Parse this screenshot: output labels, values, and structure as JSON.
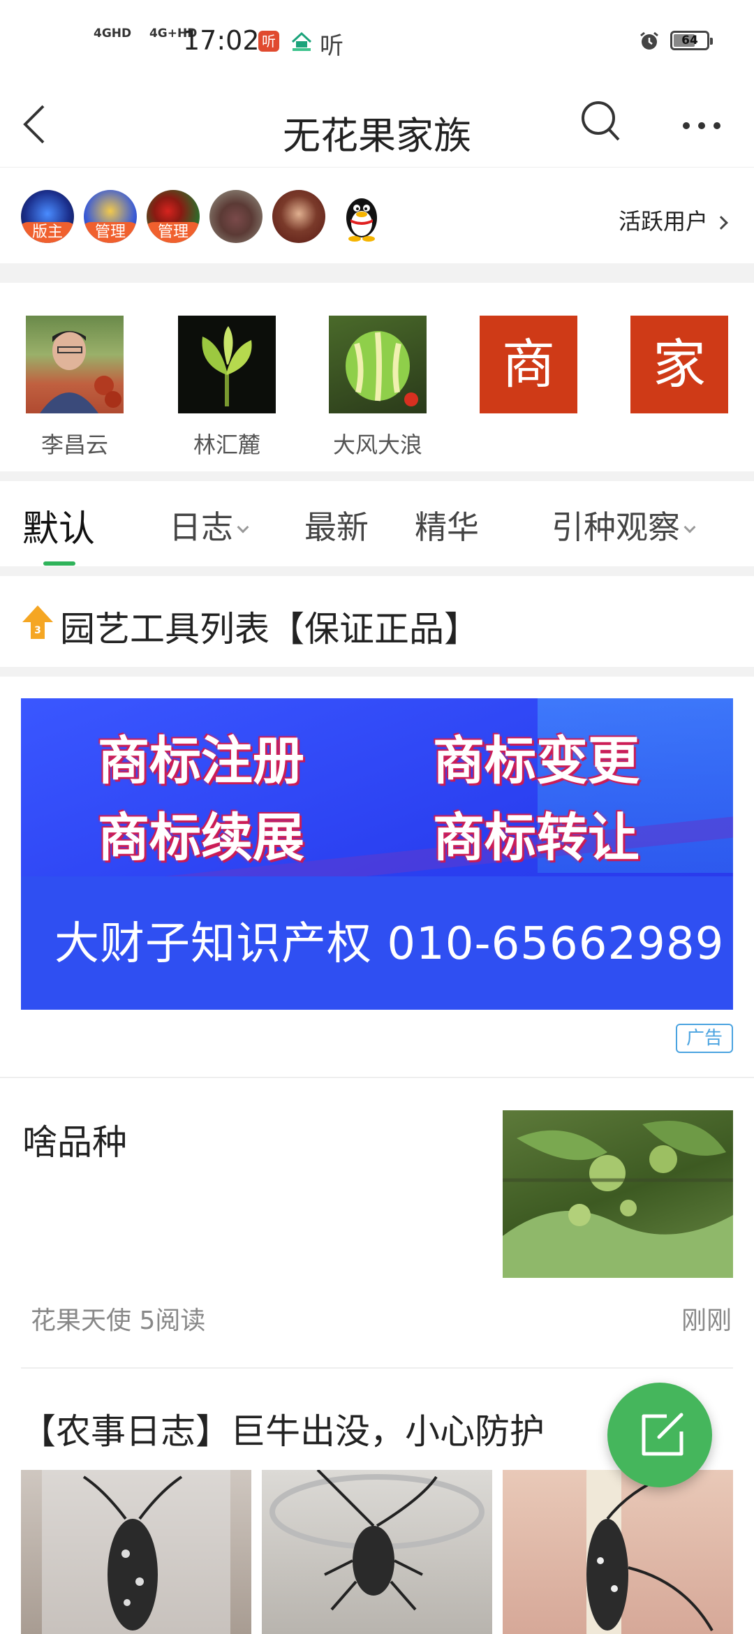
{
  "status_bar": {
    "network": [
      "4GHD",
      "4G+HD"
    ],
    "time": "17:02",
    "app_icon_1": "听",
    "app_icon_3": "听",
    "battery": "64"
  },
  "header": {
    "title": "无花果家族"
  },
  "users": {
    "badges": [
      "版主",
      "管理",
      "管理"
    ],
    "active_users_label": "活跃用户"
  },
  "members": [
    {
      "name": "李昌云"
    },
    {
      "name": "林汇麓"
    },
    {
      "name": "大风大浪"
    },
    {
      "name": "",
      "tile": "商"
    },
    {
      "name": "",
      "tile": "家"
    }
  ],
  "tabs": [
    {
      "label": "默认",
      "active": true
    },
    {
      "label": "日志",
      "dropdown": true
    },
    {
      "label": "最新"
    },
    {
      "label": "精华"
    },
    {
      "label": "引种观察",
      "dropdown": true
    }
  ],
  "pinned": {
    "title": "园艺工具列表【保证正品】"
  },
  "ad": {
    "line1_left": "商标注册",
    "line1_right": "商标变更",
    "line2_left": "商标续展",
    "line2_right": "商标转让",
    "line3": "大财子知识产权  010-65662989",
    "tag": "广告"
  },
  "posts": [
    {
      "title": "啥品种",
      "author": "花果天使",
      "reads": "5阅读",
      "time": "刚刚"
    },
    {
      "title": "【农事日志】巨牛出没，小心防护"
    }
  ],
  "colors": {
    "accent_green": "#2fb35a",
    "fab_green": "#45b65c",
    "badge_orange": "#f0602e",
    "tile_red": "#cf3a17"
  }
}
